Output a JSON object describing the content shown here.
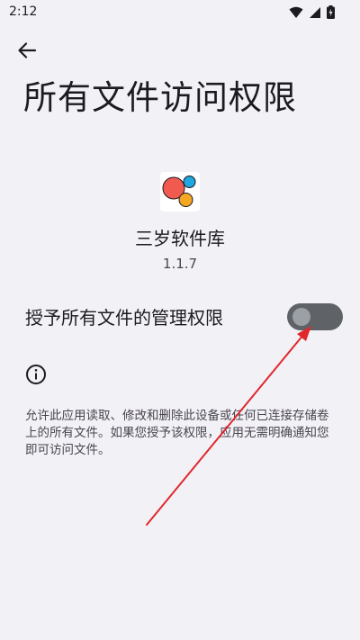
{
  "status_bar": {
    "time": "2:12",
    "icons": [
      "wifi-icon",
      "signal-icon",
      "battery-charging-icon"
    ]
  },
  "header": {
    "back_icon": "arrow-back-icon",
    "title": "所有文件访问权限"
  },
  "app": {
    "icon": "app-logo-icon",
    "name": "三岁软件库",
    "version": "1.1.7"
  },
  "permission": {
    "toggle_label": "授予所有文件的管理权限",
    "toggle_on": false
  },
  "info": {
    "icon": "info-icon",
    "text": "允许此应用读取、修改和删除此设备或任何已连接存储卷上的所有文件。如果您授予该权限，应用无需明确通知您即可访问文件。"
  },
  "colors": {
    "background": "#f2f1f6",
    "switch_track": "#5f6368",
    "switch_thumb": "#9aa0a6",
    "annotation_arrow": "#e0282c",
    "logo_red": "#f05a4f",
    "logo_blue": "#1ea7e1",
    "logo_orange": "#f5a623"
  }
}
